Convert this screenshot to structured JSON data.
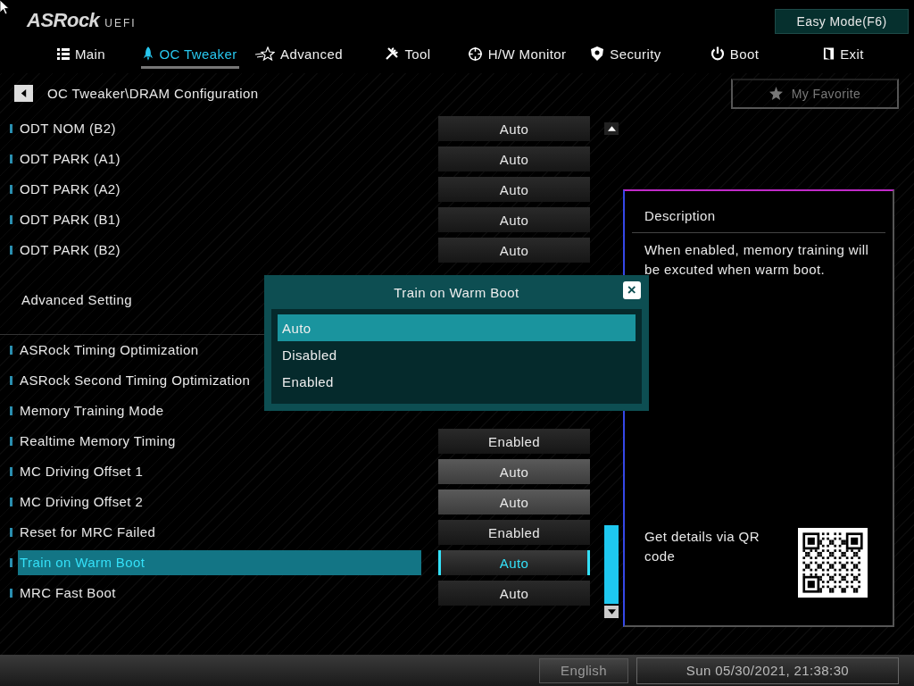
{
  "header": {
    "logo": "ASRock",
    "logo_suffix": "UEFI",
    "easy_mode_button": "Easy Mode(F6)"
  },
  "tabs": [
    {
      "label": "Main",
      "selected": false
    },
    {
      "label": "OC Tweaker",
      "selected": true
    },
    {
      "label": "Advanced",
      "selected": false
    },
    {
      "label": "Tool",
      "selected": false
    },
    {
      "label": "H/W Monitor",
      "selected": false
    },
    {
      "label": "Security",
      "selected": false
    },
    {
      "label": "Boot",
      "selected": false
    },
    {
      "label": "Exit",
      "selected": false
    }
  ],
  "breadcrumb": "OC Tweaker\\DRAM Configuration",
  "favorite_button": "My Favorite",
  "settings": [
    {
      "kind": "setting",
      "label": "ODT NOM  (B2)",
      "value": "Auto",
      "highlighted": false,
      "selected": false
    },
    {
      "kind": "setting",
      "label": "ODT PARK (A1)",
      "value": "Auto",
      "highlighted": false,
      "selected": false
    },
    {
      "kind": "setting",
      "label": "ODT PARK (A2)",
      "value": "Auto",
      "highlighted": false,
      "selected": false
    },
    {
      "kind": "setting",
      "label": "ODT PARK (B1)",
      "value": "Auto",
      "highlighted": false,
      "selected": false
    },
    {
      "kind": "setting",
      "label": "ODT PARK (B2)",
      "value": "Auto",
      "highlighted": false,
      "selected": false
    },
    {
      "kind": "section",
      "label": "Advanced Setting"
    },
    {
      "kind": "setting",
      "label": "ASRock Timing Optimization",
      "selected": false
    },
    {
      "kind": "setting",
      "label": "ASRock Second Timing Optimization",
      "selected": false
    },
    {
      "kind": "setting",
      "label": "Memory Training Mode",
      "selected": false
    },
    {
      "kind": "setting",
      "label": "Realtime Memory Timing",
      "value": "Enabled",
      "highlighted": false,
      "selected": false
    },
    {
      "kind": "setting",
      "label": "MC Driving Offset 1",
      "value": "Auto",
      "highlighted": true,
      "selected": false
    },
    {
      "kind": "setting",
      "label": "MC Driving Offset 2",
      "value": "Auto",
      "highlighted": true,
      "selected": false
    },
    {
      "kind": "setting",
      "label": "Reset for MRC Failed",
      "value": "Enabled",
      "highlighted": false,
      "selected": false
    },
    {
      "kind": "setting",
      "label": "Train on Warm Boot",
      "value": "Auto",
      "highlighted": false,
      "selected": true
    },
    {
      "kind": "setting",
      "label": "MRC Fast Boot",
      "value": "Auto",
      "highlighted": false,
      "selected": false
    }
  ],
  "popup": {
    "title": "Train on Warm Boot",
    "close": "×",
    "options": [
      {
        "label": "Auto",
        "selected": true
      },
      {
        "label": "Disabled",
        "selected": false
      },
      {
        "label": "Enabled",
        "selected": false
      }
    ]
  },
  "description": {
    "title": "Description",
    "text": "When enabled, memory training will be excuted when warm boot.",
    "qr_text": "Get details via QR code"
  },
  "status_bar": {
    "language": "English",
    "datetime": "Sun 05/30/2021, 21:38:30"
  }
}
